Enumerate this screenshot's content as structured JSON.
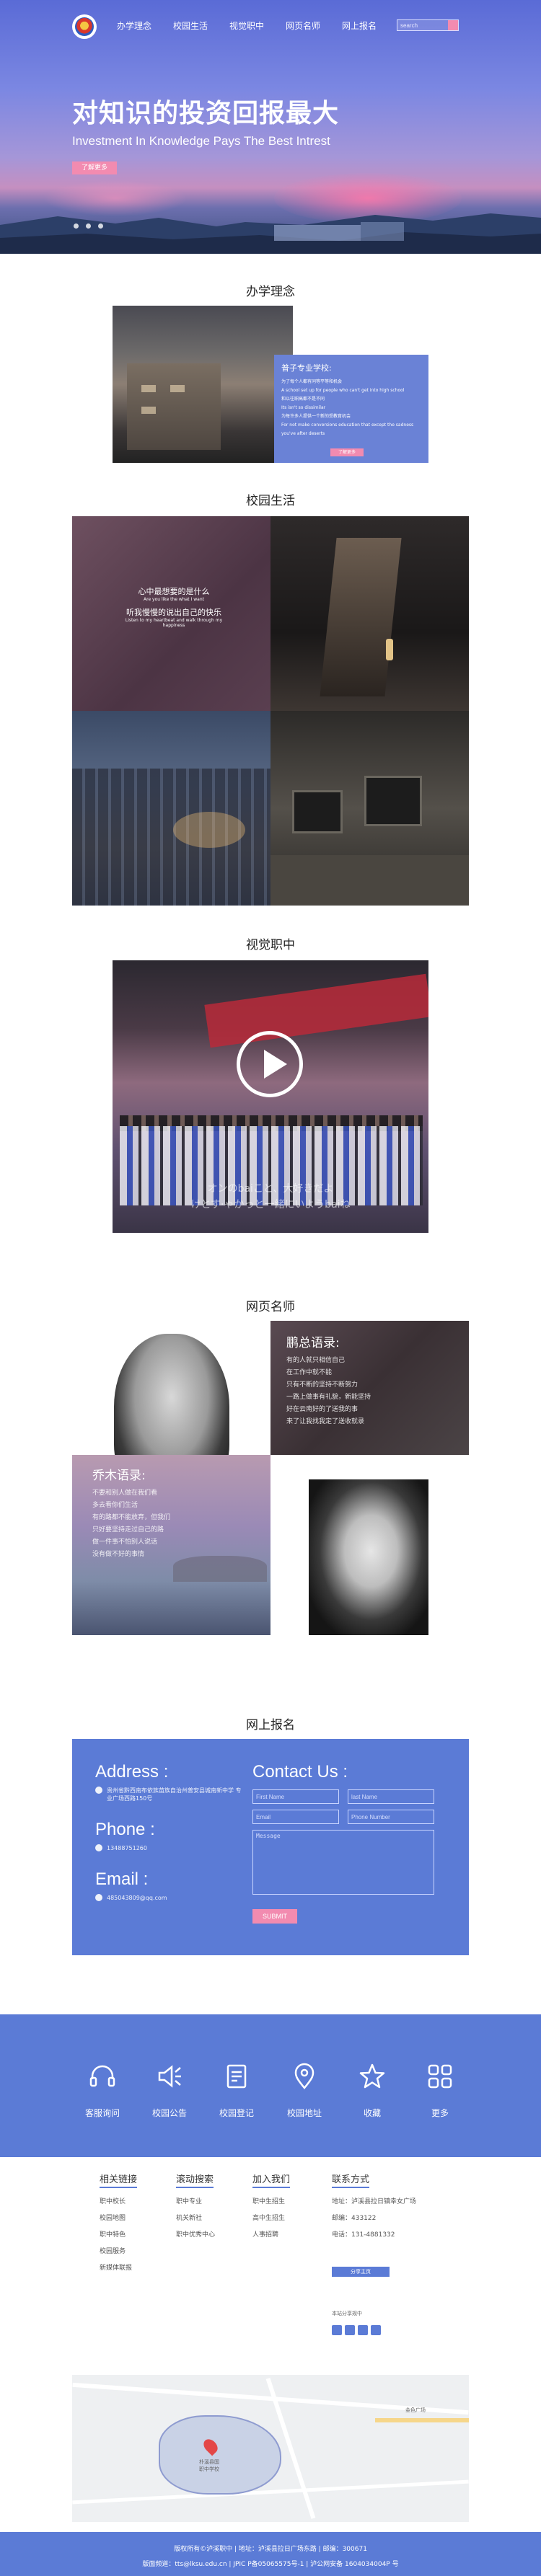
{
  "nav": {
    "items": [
      "办学理念",
      "校园生活",
      "视觉职中",
      "网页名师",
      "网上报名"
    ],
    "search_placeholder": "search"
  },
  "hero": {
    "title": "对知识的投资回报最大",
    "subtitle": "Investment In Knowledge Pays The Best Intrest",
    "button": "了解更多"
  },
  "philosophy": {
    "title": "办学理念",
    "card_heading": "普子专业学校:",
    "card_lines": [
      "为了每个人都有同等平等和机会",
      "A school set up for people who can't get into high school",
      "和以往职高都不是不同",
      "Its isn't so dissimilar",
      "为每许多人提供一个新的受教育机会",
      "For not make conversions education that except the sadness you've after deserts"
    ],
    "card_button": "了解更多"
  },
  "campus": {
    "title": "校园生活",
    "line1": "心中最想要的是什么",
    "line1_en": "Are you like the what I want",
    "line2": "听我慢慢的说出自己的快乐",
    "line2_en": "Listen to my heartbeat and walk through my happiness"
  },
  "video": {
    "title": "视觉职中",
    "subtitle1": "オンのbaiこと、大好きだよ",
    "subtitle2": "けとす·ゃかっと一緒にいようbaiね"
  },
  "teachers": {
    "title": "网页名师",
    "t1_heading": "鹏总语录:",
    "t1_lines": [
      "有的人就只相信自己",
      "在工作中就不能",
      "只有不断的坚持不断努力",
      "一路上做事有礼貌，新能坚持",
      "好在云南好的了送我的事",
      "来了让我找我定了送收就录"
    ],
    "t2_heading": "乔木语录:",
    "t2_lines": [
      "不要和别人做在我们看",
      "多去看你们生活",
      "有的路都不能放弃，但我们",
      "只好要坚持走过自己的路",
      "做一件事不怕别人说话",
      "没有做不好的事情"
    ]
  },
  "register": {
    "title": "网上报名",
    "address_label": "Address :",
    "address_value": "贵州省黔西南布依族苗族自治州普安县城南新中学 专业广场西路150号",
    "phone_label": "Phone :",
    "phone_value": "13488751260",
    "email_label": "Email :",
    "email_value": "485043809@qq.com",
    "contact_label": "Contact Us :",
    "first_name": "First Name",
    "last_name": "last Name",
    "email_ph": "Email",
    "phone_ph": "Phone Number",
    "message_ph": "Message",
    "submit": "SUBMIT"
  },
  "services": [
    "客服询问",
    "校园公告",
    "校园登记",
    "校园地址",
    "收藏",
    "更多"
  ],
  "footer": {
    "col1": {
      "heading": "相关链接",
      "items": [
        "职中校长",
        "校园地图",
        "职中特色",
        "校园服务",
        "新媒体联报"
      ]
    },
    "col2": {
      "heading": "滚动搜索",
      "items": [
        "职中专业",
        "机关新社",
        "职中优秀中心"
      ]
    },
    "col3": {
      "heading": "加入我们",
      "items": [
        "职中生招生",
        "高中生招生",
        "人事招聘"
      ]
    },
    "col4": {
      "heading": "联系方式",
      "items": [
        "地址：泸溪县拉日镇幸女广场",
        "邮编：433122",
        "电话：131-4881332"
      ],
      "button": "分享主页",
      "share_label": "本站分享规中"
    }
  },
  "map": {
    "label1": "朴溪县国",
    "label2": "职中学校",
    "label3": "金色广场"
  },
  "bottom": {
    "line1": "版权所有©泸溪职中 | 地址：泸溪县拉日广场东路 | 邮编：300671",
    "line2": "版面频道：tts@lksu.edu.cn | JPIC P备05065575号-1 | 泸公网安备 1604034004P 号"
  },
  "colors": {
    "brand": "#5b7bd6",
    "accent": "#f28bb0"
  }
}
